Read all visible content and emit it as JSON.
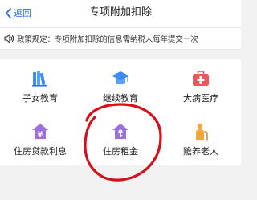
{
  "navbar": {
    "back_label": "返回",
    "title": "专项附加扣除"
  },
  "notice": {
    "text": "政策规定：专项附加扣除的信息需纳税人每年提交一次"
  },
  "grid": {
    "items": [
      {
        "label": "子女教育",
        "icon": "books-icon"
      },
      {
        "label": "继续教育",
        "icon": "graduation-cap-icon"
      },
      {
        "label": "大病医疗",
        "icon": "medical-kit-icon"
      },
      {
        "label": "住房贷款利息",
        "icon": "house-loan-icon"
      },
      {
        "label": "住房租金",
        "icon": "house-key-icon"
      },
      {
        "label": "赡养老人",
        "icon": "elderly-person-icon"
      }
    ]
  },
  "colors": {
    "accent_blue": "#2a6fe8",
    "icon_blue": "#3d8bfd",
    "icon_red": "#f2545b",
    "icon_purple": "#9b6fe0",
    "icon_orange": "#f3a63b",
    "annotation_red": "#d4101a"
  }
}
